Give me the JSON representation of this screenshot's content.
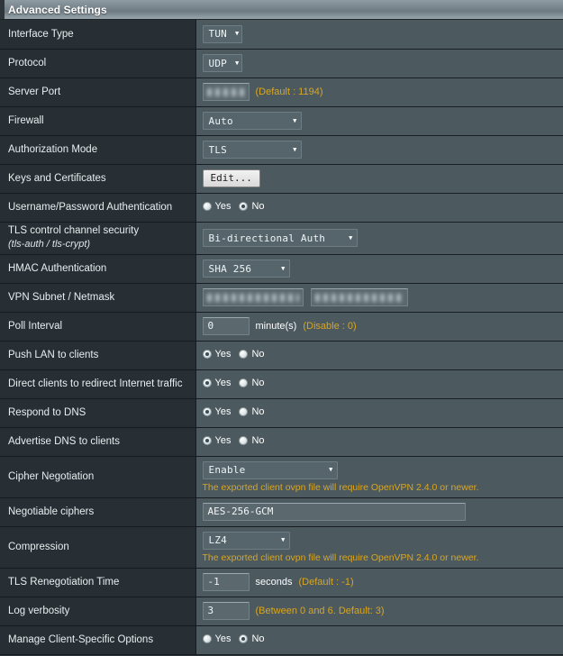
{
  "panel": {
    "title": "Advanced Settings"
  },
  "rows": [
    {
      "label": "Interface Type",
      "control": "select",
      "value": "TUN"
    },
    {
      "label": "Protocol",
      "control": "select",
      "value": "UDP"
    },
    {
      "label": "Server Port",
      "control": "text-hint",
      "value": "",
      "hint": "(Default : 1194)"
    },
    {
      "label": "Firewall",
      "control": "select",
      "value": "Auto"
    },
    {
      "label": "Authorization Mode",
      "control": "select",
      "value": "TLS"
    },
    {
      "label": "Keys and Certificates",
      "control": "button",
      "value": "Edit..."
    },
    {
      "label": "Username/Password Authentication",
      "control": "radio",
      "yes_label": "Yes",
      "no_label": "No",
      "selected": "No"
    },
    {
      "label": "TLS control channel security",
      "label_sub": "(tls-auth / tls-crypt)",
      "control": "select",
      "value": "Bi-directional Auth"
    },
    {
      "label": "HMAC Authentication",
      "control": "select",
      "value": "SHA 256"
    },
    {
      "label": "VPN Subnet / Netmask",
      "control": "two-text",
      "value": "",
      "value2": ""
    },
    {
      "label": "Poll Interval",
      "control": "text-unit-hint",
      "value": "0",
      "unit": "minute(s)",
      "hint": "(Disable : 0)"
    },
    {
      "label": "Push LAN to clients",
      "control": "radio",
      "yes_label": "Yes",
      "no_label": "No",
      "selected": "Yes"
    },
    {
      "label": "Direct clients to redirect Internet traffic",
      "control": "radio",
      "yes_label": "Yes",
      "no_label": "No",
      "selected": "Yes"
    },
    {
      "label": "Respond to DNS",
      "control": "radio",
      "yes_label": "Yes",
      "no_label": "No",
      "selected": "Yes"
    },
    {
      "label": "Advertise DNS to clients",
      "control": "radio",
      "yes_label": "Yes",
      "no_label": "No",
      "selected": "Yes"
    },
    {
      "label": "Cipher Negotiation",
      "control": "select-warn",
      "value": "Enable",
      "warn": "The exported client ovpn file will require OpenVPN 2.4.0 or newer."
    },
    {
      "label": "Negotiable ciphers",
      "control": "text-wide",
      "value": "AES-256-GCM"
    },
    {
      "label": "Compression",
      "control": "select-warn",
      "value": "LZ4",
      "warn": "The exported client ovpn file will require OpenVPN 2.4.0 or newer."
    },
    {
      "label": "TLS Renegotiation Time",
      "control": "text-unit-hint",
      "value": "-1",
      "unit": "seconds",
      "hint": "(Default : -1)"
    },
    {
      "label": "Log verbosity",
      "control": "text-hint",
      "value": "3",
      "hint": "(Between 0 and 6. Default: 3)"
    },
    {
      "label": "Manage Client-Specific Options",
      "control": "radio",
      "yes_label": "Yes",
      "no_label": "No",
      "selected": "No"
    }
  ],
  "icons": {
    "dropdown_arrow": "▼"
  },
  "colors": {
    "label_bg": "#272f34",
    "value_bg": "#4c5a60",
    "hint_text": "#d9a520",
    "title_text": "#ffffff"
  }
}
